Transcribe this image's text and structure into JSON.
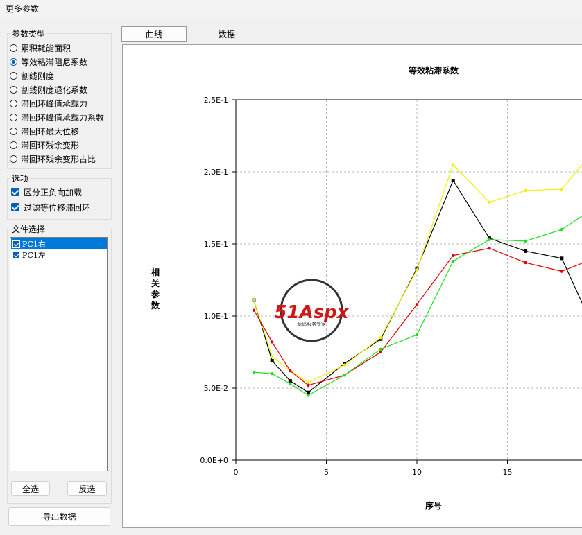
{
  "window": {
    "title": "更多参数"
  },
  "param_type": {
    "legend": "参数类型",
    "options": [
      "累积耗能面积",
      "等效粘滞阻尼系数",
      "割线刚度",
      "割线刚度退化系数",
      "滞回环峰值承载力",
      "滞回环峰值承载力系数",
      "滞回环最大位移",
      "滞回环残余变形",
      "滞回环残余变形占比"
    ],
    "selected": "等效粘滞阻尼系数"
  },
  "options": {
    "legend": "选项",
    "items": [
      {
        "label": "区分正负向加载",
        "checked": true
      },
      {
        "label": "过滤等位移滞回环",
        "checked": true
      }
    ]
  },
  "file_select": {
    "legend": "文件选择",
    "files": [
      {
        "label": "PC1右",
        "checked": true,
        "selected": true
      },
      {
        "label": "PC1左",
        "checked": true,
        "selected": false
      }
    ],
    "select_all": "全选",
    "invert": "反选"
  },
  "export_button": "导出数据",
  "tabs": [
    {
      "label": "曲线",
      "active": true
    },
    {
      "label": "数据",
      "active": false
    }
  ],
  "watermark": {
    "text": "51Aspx",
    "sub": "源码服务专家"
  },
  "colors": {
    "black": "#000000",
    "yellow": "#f0f000",
    "red": "#e00000",
    "green": "#22dd22",
    "accent": "#005fb8"
  },
  "chart_data": {
    "type": "line",
    "title": "等效粘滞系数",
    "xlabel": "序号",
    "ylabel": "相关参数",
    "xticks": [
      "0",
      "5",
      "10",
      "15"
    ],
    "yticks": [
      "0.0E+0",
      "5.0E-2",
      "1.0E-1",
      "1.5E-1",
      "2.0E-1",
      "2.5E-1"
    ],
    "xlim": [
      0,
      19.2
    ],
    "ylim": [
      0,
      0.25
    ],
    "grid": true,
    "series": [
      {
        "color": "#000000",
        "marker": "square",
        "x": [
          1,
          2,
          3,
          4,
          6,
          8,
          10,
          12,
          14,
          16,
          18,
          19.2
        ],
        "y": [
          0.111,
          0.069,
          0.055,
          0.047,
          0.067,
          0.084,
          0.133,
          0.194,
          0.154,
          0.145,
          0.14,
          0.107
        ]
      },
      {
        "color": "#f0f000",
        "marker": "circle",
        "x": [
          1,
          2,
          3,
          4,
          6,
          8,
          10,
          12,
          14,
          16,
          18,
          19.2
        ],
        "y": [
          0.111,
          0.072,
          0.062,
          0.054,
          0.066,
          0.085,
          0.132,
          0.205,
          0.179,
          0.187,
          0.188,
          0.206
        ]
      },
      {
        "color": "#e00000",
        "marker": "circle",
        "x": [
          1,
          2,
          3,
          4,
          6,
          8,
          10,
          12,
          14,
          16,
          18,
          19.2
        ],
        "y": [
          0.104,
          0.082,
          0.062,
          0.052,
          0.059,
          0.075,
          0.108,
          0.142,
          0.147,
          0.137,
          0.131,
          0.137
        ]
      },
      {
        "color": "#22dd22",
        "marker": "circle",
        "x": [
          1,
          2,
          3,
          4,
          6,
          8,
          10,
          12,
          14,
          16,
          18,
          19.2
        ],
        "y": [
          0.061,
          0.06,
          0.053,
          0.045,
          0.059,
          0.077,
          0.087,
          0.138,
          0.153,
          0.152,
          0.16,
          0.17
        ]
      }
    ]
  }
}
